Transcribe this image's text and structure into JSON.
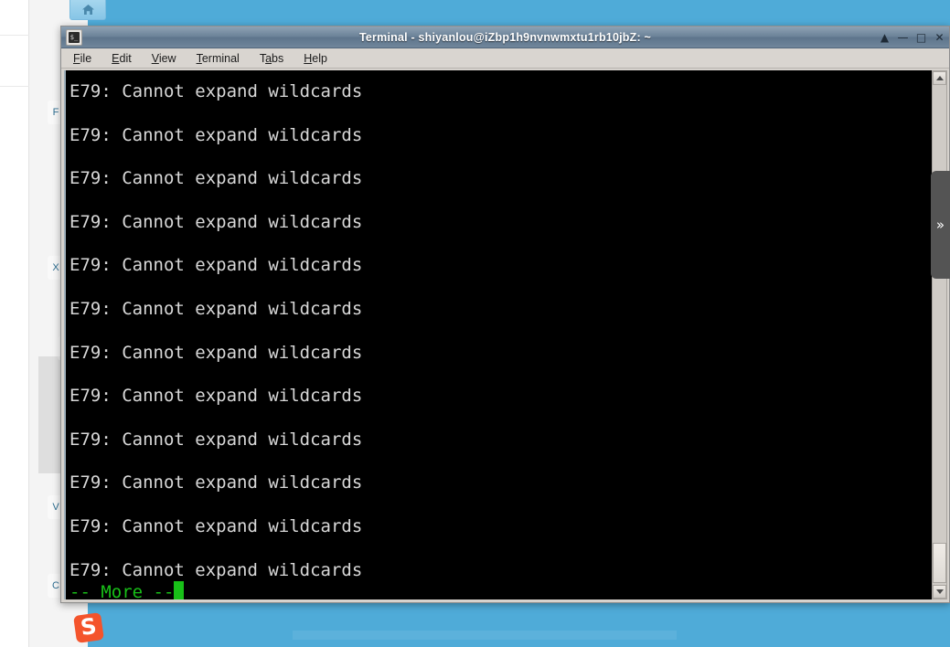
{
  "desktop": {
    "background_color": "#4fabd8",
    "home_button_label": "home-icon",
    "logo_text": "S",
    "logo_color": "#f4542c",
    "taskbar_hint": "",
    "hidden_labels": [
      "F",
      "X",
      "|",
      "V",
      "C"
    ]
  },
  "left_rail": {
    "scroll_up_icon": "triangle-up-icon",
    "collapse_icon": "‹"
  },
  "window": {
    "title": "Terminal - shiyanlou@iZbp1h9nvnwmxtu1rb10jbZ: ~",
    "icon_glyph": "$_",
    "controls": {
      "shade": "▲",
      "minimize": "—",
      "maximize": "□",
      "close": "✕"
    },
    "menu": [
      {
        "label": "File",
        "mnemonic": "F"
      },
      {
        "label": "Edit",
        "mnemonic": "E"
      },
      {
        "label": "View",
        "mnemonic": "V"
      },
      {
        "label": "Terminal",
        "mnemonic": "T"
      },
      {
        "label": "Tabs",
        "mnemonic": "a"
      },
      {
        "label": "Help",
        "mnemonic": "H"
      }
    ]
  },
  "terminal": {
    "fg_color": "#d8d8d8",
    "bg_color": "#000000",
    "prompt_color": "#18c018",
    "lines": [
      "E79: Cannot expand wildcards",
      "E79: Cannot expand wildcards",
      "E79: Cannot expand wildcards",
      "E79: Cannot expand wildcards",
      "E79: Cannot expand wildcards",
      "E79: Cannot expand wildcards",
      "E79: Cannot expand wildcards",
      "E79: Cannot expand wildcards",
      "E79: Cannot expand wildcards",
      "E79: Cannot expand wildcards",
      "E79: Cannot expand wildcards",
      "E79: Cannot expand wildcards"
    ],
    "status_line": "-- More --",
    "scrollbar": {
      "up_arrow": "triangle-up-icon",
      "down_arrow": "triangle-down-icon"
    }
  },
  "edge_tab": {
    "icon": "»"
  }
}
